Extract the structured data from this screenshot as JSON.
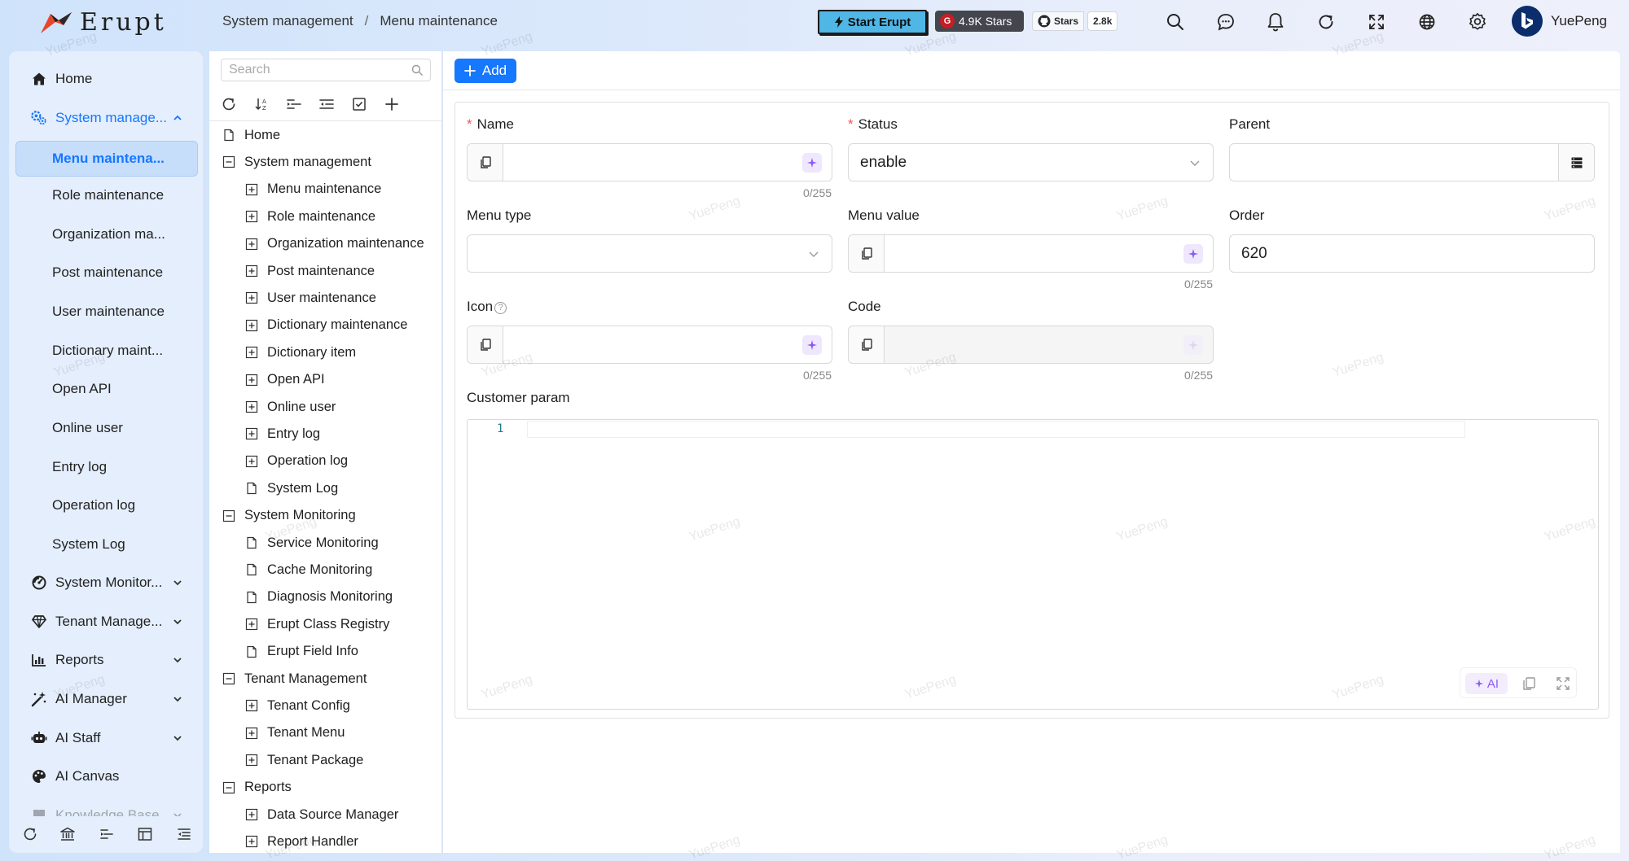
{
  "header": {
    "logo_text": "Erupt",
    "breadcrumb": [
      "System management",
      "Menu maintenance"
    ],
    "start_button": "Start Erupt",
    "gitee_badge": "4.9K Stars",
    "github_label": "Stars",
    "github_count": "2.8k",
    "icons": [
      "search-icon",
      "chat-icon",
      "bell-icon",
      "refresh-icon",
      "fullscreen-icon",
      "globe-icon",
      "settings-icon"
    ],
    "user_name": "YuePeng"
  },
  "sidebar": {
    "items": [
      {
        "label": "Home",
        "icon": "home-icon"
      },
      {
        "label": "System manage...",
        "icon": "settings-group-icon",
        "expanded": true
      },
      {
        "label": "Menu maintena...",
        "selected": true
      },
      {
        "label": "Role maintenance"
      },
      {
        "label": "Organization ma..."
      },
      {
        "label": "Post maintenance"
      },
      {
        "label": "User maintenance"
      },
      {
        "label": "Dictionary maint..."
      },
      {
        "label": "Open API"
      },
      {
        "label": "Online user"
      },
      {
        "label": "Entry log"
      },
      {
        "label": "Operation log"
      },
      {
        "label": "System Log"
      },
      {
        "label": "System Monitor...",
        "icon": "dashboard-icon"
      },
      {
        "label": "Tenant Manage...",
        "icon": "diamond-icon"
      },
      {
        "label": "Reports",
        "icon": "bar-chart-icon"
      },
      {
        "label": "AI Manager",
        "icon": "magic-wand-icon"
      },
      {
        "label": "AI Staff",
        "icon": "robot-icon"
      },
      {
        "label": "AI Canvas",
        "icon": "palette-icon"
      },
      {
        "label": "Knowledge Base",
        "icon": "book-icon"
      }
    ]
  },
  "tree": {
    "search_placeholder": "Search",
    "nodes": [
      {
        "label": "Home",
        "level": 0,
        "type": "leaf"
      },
      {
        "label": "System management",
        "level": 0,
        "type": "expanded"
      },
      {
        "label": "Menu maintenance",
        "level": 1,
        "type": "collapsed"
      },
      {
        "label": "Role maintenance",
        "level": 1,
        "type": "collapsed"
      },
      {
        "label": "Organization maintenance",
        "level": 1,
        "type": "collapsed"
      },
      {
        "label": "Post maintenance",
        "level": 1,
        "type": "collapsed"
      },
      {
        "label": "User maintenance",
        "level": 1,
        "type": "collapsed"
      },
      {
        "label": "Dictionary maintenance",
        "level": 1,
        "type": "collapsed"
      },
      {
        "label": "Dictionary item",
        "level": 1,
        "type": "collapsed"
      },
      {
        "label": "Open API",
        "level": 1,
        "type": "collapsed"
      },
      {
        "label": "Online user",
        "level": 1,
        "type": "collapsed"
      },
      {
        "label": "Entry log",
        "level": 1,
        "type": "collapsed"
      },
      {
        "label": "Operation log",
        "level": 1,
        "type": "collapsed"
      },
      {
        "label": "System Log",
        "level": 1,
        "type": "leaf"
      },
      {
        "label": "System Monitoring",
        "level": 0,
        "type": "expanded"
      },
      {
        "label": "Service Monitoring",
        "level": 1,
        "type": "leaf"
      },
      {
        "label": "Cache Monitoring",
        "level": 1,
        "type": "leaf"
      },
      {
        "label": "Diagnosis Monitoring",
        "level": 1,
        "type": "leaf"
      },
      {
        "label": "Erupt Class Registry",
        "level": 1,
        "type": "collapsed"
      },
      {
        "label": "Erupt Field Info",
        "level": 1,
        "type": "leaf"
      },
      {
        "label": "Tenant Management",
        "level": 0,
        "type": "expanded"
      },
      {
        "label": "Tenant Config",
        "level": 1,
        "type": "collapsed"
      },
      {
        "label": "Tenant Menu",
        "level": 1,
        "type": "collapsed"
      },
      {
        "label": "Tenant Package",
        "level": 1,
        "type": "collapsed"
      },
      {
        "label": "Reports",
        "level": 0,
        "type": "expanded"
      },
      {
        "label": "Data Source Manager",
        "level": 1,
        "type": "collapsed"
      },
      {
        "label": "Report Handler",
        "level": 1,
        "type": "collapsed"
      }
    ]
  },
  "main": {
    "add_button": "Add",
    "form": {
      "name": {
        "label": "Name",
        "required": true,
        "value": "",
        "counter": "0/255"
      },
      "status": {
        "label": "Status",
        "required": true,
        "value": "enable"
      },
      "parent": {
        "label": "Parent",
        "value": ""
      },
      "menu_type": {
        "label": "Menu type",
        "value": ""
      },
      "menu_value": {
        "label": "Menu value",
        "value": "",
        "counter": "0/255"
      },
      "order": {
        "label": "Order",
        "value": "620"
      },
      "icon": {
        "label": "Icon",
        "value": "",
        "counter": "0/255"
      },
      "code": {
        "label": "Code",
        "value": "",
        "counter": "0/255",
        "disabled": true
      },
      "customer_param": {
        "label": "Customer param",
        "line_number": "1",
        "ai_label": "AI"
      }
    }
  },
  "watermark_text": "YuePeng",
  "colors": {
    "primary": "#1677ff",
    "required": "#ff4d4f",
    "ai_purple": "#8a5cf5",
    "start_button": "#4fb6e6"
  }
}
